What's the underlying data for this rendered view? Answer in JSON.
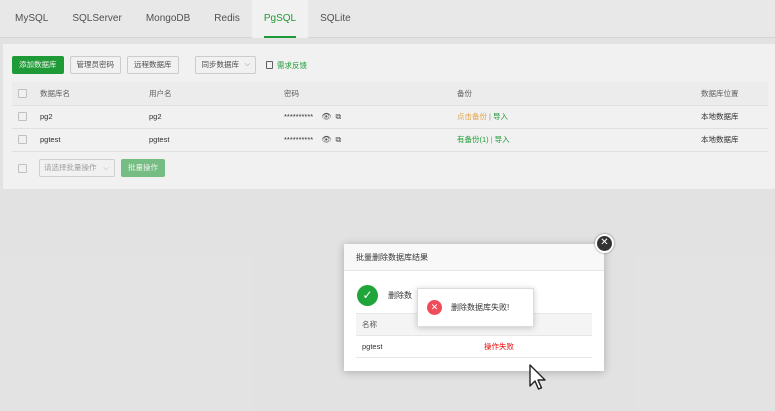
{
  "tabs": [
    {
      "label": "MySQL"
    },
    {
      "label": "SQLServer"
    },
    {
      "label": "MongoDB"
    },
    {
      "label": "Redis"
    },
    {
      "label": "PgSQL",
      "active": true
    },
    {
      "label": "SQLite"
    }
  ],
  "toolbar": {
    "add_db": "添加数据库",
    "admin_pwd": "管理员密码",
    "remote_db": "远程数据库",
    "sync_db": "同步数据库",
    "feedback": "需求反馈"
  },
  "table": {
    "headers": {
      "name": "数据库名",
      "user": "用户名",
      "password": "密码",
      "backup": "备份",
      "location": "数据库位置"
    },
    "rows": [
      {
        "name": "pg2",
        "user": "pg2",
        "password": "**********",
        "backup": "点击备份",
        "import": "导入",
        "location": "本地数据库"
      },
      {
        "name": "pgtest",
        "user": "pgtest",
        "password": "**********",
        "backup": "有备份(1)",
        "import": "导入",
        "location": "本地数据库"
      }
    ]
  },
  "batch": {
    "placeholder": "请选择批量操作",
    "run": "批量操作"
  },
  "modal": {
    "title": "批量删除数据库结果",
    "summary": "删除数",
    "col_name": "名称",
    "result_row": {
      "name": "pgtest",
      "status": "操作失败"
    }
  },
  "toast": {
    "message": "删除数据库失败!"
  },
  "colors": {
    "brand": "#20a53a",
    "error": "#ef4b5b",
    "fail_text": "#ef0808",
    "backup_orange": "#f0ad4e"
  }
}
